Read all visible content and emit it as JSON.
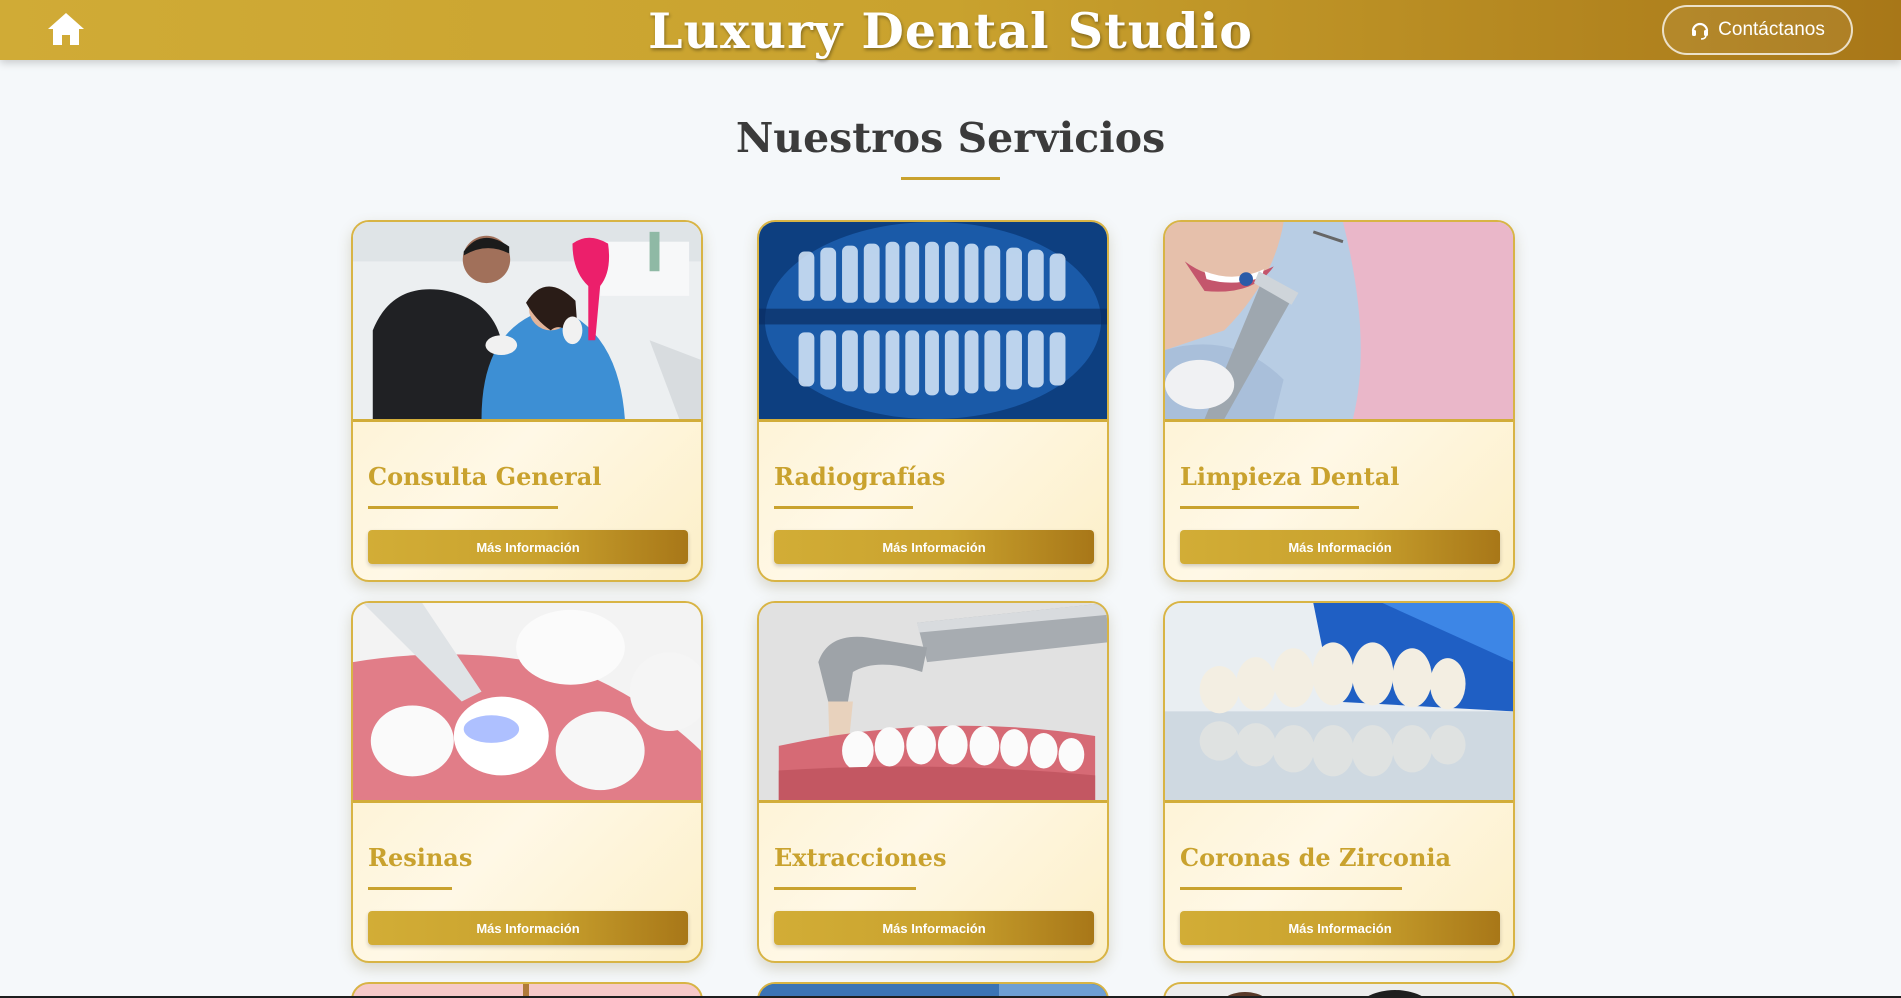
{
  "header": {
    "home_icon": "home-icon",
    "title": "Luxury Dental Studio",
    "contact_label": "Contáctanos",
    "contact_icon": "headset-icon"
  },
  "colors": {
    "gold": "#c9a22e",
    "gold_dark": "#a87718",
    "card_bg": "#fcefc8",
    "page_bg": "#f5f8fa",
    "heading": "#3b3b3b"
  },
  "main": {
    "section_title": "Nuestros Servicios",
    "services": [
      {
        "title": "Consulta General",
        "button": "Más Información",
        "image": "dentist-patient-photo"
      },
      {
        "title": "Radiografías",
        "button": "Más Información",
        "image": "dental-xray-photo"
      },
      {
        "title": "Limpieza Dental",
        "button": "Más Información",
        "image": "dental-cleaning-photo"
      },
      {
        "title": "Resinas",
        "button": "Más Información",
        "image": "resin-filling-render"
      },
      {
        "title": "Extracciones",
        "button": "Más Información",
        "image": "tooth-extraction-render"
      },
      {
        "title": "Coronas de Zirconia",
        "button": "Más Información",
        "image": "zirconia-crowns-photo"
      }
    ]
  }
}
